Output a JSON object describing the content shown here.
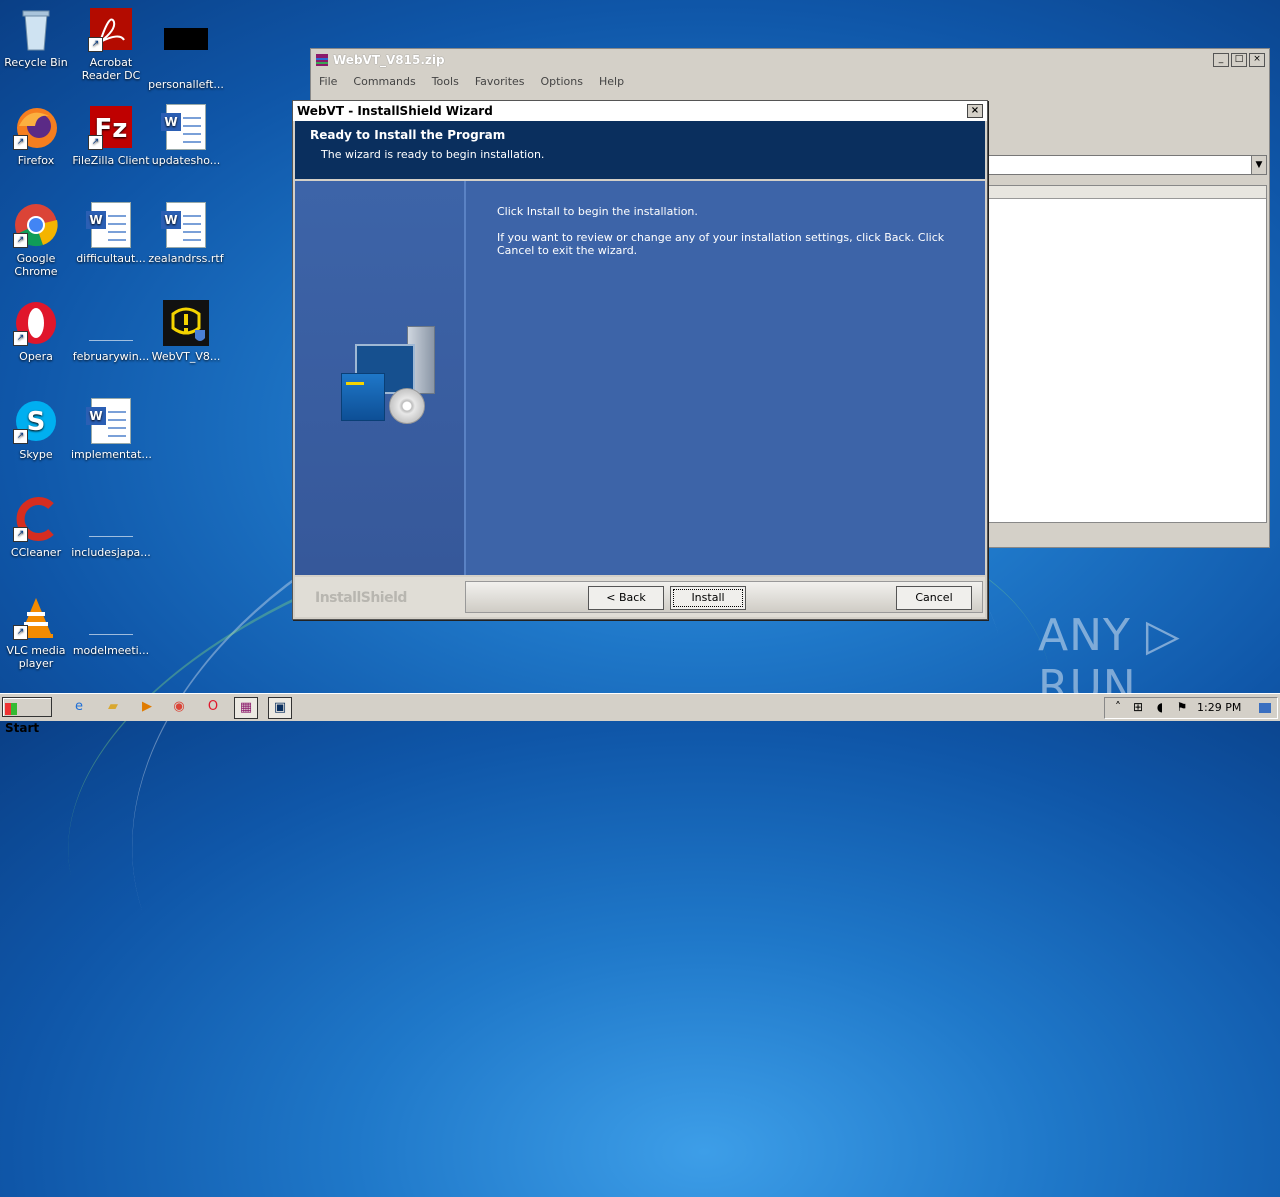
{
  "desktop": {
    "icons": [
      {
        "label": "Recycle Bin"
      },
      {
        "label": "Acrobat Reader DC"
      },
      {
        "label": "personalleft..."
      },
      {
        "label": "Firefox"
      },
      {
        "label": "FileZilla Client"
      },
      {
        "label": "updatesho..."
      },
      {
        "label": "Google Chrome"
      },
      {
        "label": "difficultaut..."
      },
      {
        "label": "zealandrss.rtf"
      },
      {
        "label": "Opera"
      },
      {
        "label": "februarywin..."
      },
      {
        "label": "WebVT_V8..."
      },
      {
        "label": "Skype"
      },
      {
        "label": "implementat..."
      },
      {
        "label": "CCleaner"
      },
      {
        "label": "includesjapa..."
      },
      {
        "label": "VLC media player"
      },
      {
        "label": "modelmeeti..."
      }
    ]
  },
  "winrar": {
    "title": "WebVT_V815.zip",
    "menu": [
      "File",
      "Commands",
      "Tools",
      "Favorites",
      "Options",
      "Help"
    ]
  },
  "dialog": {
    "title": "WebVT - InstallShield Wizard",
    "heading": "Ready to Install the Program",
    "subheading": "The wizard is ready to begin installation.",
    "body1": "Click Install to begin the installation.",
    "body2": "If you want to review or change any of your installation settings, click Back. Click Cancel to exit the wizard.",
    "brand": "InstallShield",
    "back_label": "< Back",
    "install_label": "Install",
    "cancel_label": "Cancel"
  },
  "watermark": "ANY ▷ RUN",
  "taskbar": {
    "start_label": "Start",
    "clock": "1:29 PM"
  }
}
